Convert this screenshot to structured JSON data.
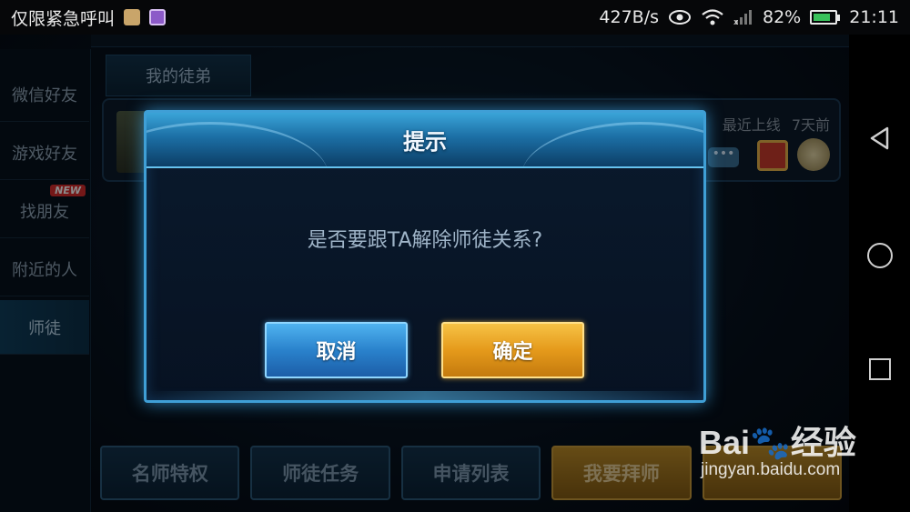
{
  "status_bar": {
    "left_text": "仅限紧急呼叫",
    "net_speed": "427B/s",
    "battery_pct": "82%",
    "battery_level": 0.82,
    "time": "21:11"
  },
  "sidebar": {
    "items": [
      {
        "label": "微信好友"
      },
      {
        "label": "游戏好友"
      },
      {
        "label": "找朋友",
        "badge": "NEW"
      },
      {
        "label": "附近的人"
      },
      {
        "label": "师徒"
      }
    ]
  },
  "tabs": {
    "disciple": "我的徒弟"
  },
  "friend_card": {
    "last_online_label": "最近上线",
    "last_online_value": "7天前",
    "chat_glyph": "•••"
  },
  "bottom_buttons": [
    {
      "label": "名师特权"
    },
    {
      "label": "师徒任务"
    },
    {
      "label": "申请列表"
    },
    {
      "label": "我要拜师"
    }
  ],
  "dialog": {
    "title": "提示",
    "message": "是否要跟TA解除师徒关系?",
    "cancel_label": "取消",
    "confirm_label": "确定"
  },
  "watermark": {
    "logo": "Bai🐾经验",
    "url": "jingyan.baidu.com"
  },
  "colors": {
    "dialog_border": "#3f9fd6",
    "cancel_button": "#2a82cc",
    "confirm_button": "#e59a1b"
  }
}
